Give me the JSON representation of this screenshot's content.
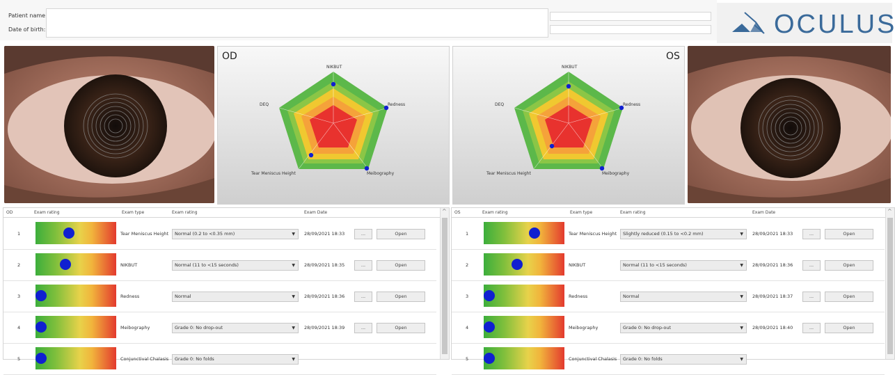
{
  "header": {
    "patient_name_label": "Patient name:",
    "dob_label": "Date of birth:",
    "patient_name_value": "",
    "dob_value": ""
  },
  "logo": {
    "text": "OCULUS",
    "reg": "®"
  },
  "colors": {
    "brand": "#3a6a9a",
    "dot": "#1020d0",
    "green": "#3cae3c",
    "yellow": "#e8d24a",
    "red": "#e33a2e"
  },
  "radar_od": {
    "title": "OD",
    "axes": [
      "NIKBUT",
      "Redness",
      "Meibography",
      "Tear Meniscus Height",
      "DEQ"
    ]
  },
  "radar_os": {
    "title": "OS",
    "axes": [
      "NIKBUT",
      "Redness",
      "Meibography",
      "Tear Meniscus Height",
      "DEQ"
    ]
  },
  "table_od": {
    "headers": {
      "eye": "OD",
      "rating_bar": "Exam rating",
      "type": "Exam type",
      "rating": "Exam rating",
      "date": "Exam Date"
    },
    "rows": [
      {
        "num": "1",
        "level": 0.4,
        "type": "Tear Meniscus Height",
        "rating": "Normal (0.2 to <0.35 mm)",
        "date": "28/09/2021 18:33",
        "more": "...",
        "open": "Open"
      },
      {
        "num": "2",
        "level": 0.35,
        "type": "NIKBUT",
        "rating": "Normal (11 to <15 seconds)",
        "date": "28/09/2021 18:35",
        "more": "...",
        "open": "Open"
      },
      {
        "num": "3",
        "level": 0.0,
        "type": "Redness",
        "rating": "Normal",
        "date": "28/09/2021 18:36",
        "more": "...",
        "open": "Open"
      },
      {
        "num": "4",
        "level": 0.0,
        "type": "Meibography",
        "rating": "Grade 0: No drop-out",
        "date": "28/09/2021 18:39",
        "more": "...",
        "open": "Open"
      },
      {
        "num": "5",
        "level": 0.0,
        "type": "Conjunctival Chalasis",
        "rating": "Grade 0: No folds",
        "date": "",
        "more": "",
        "open": ""
      }
    ]
  },
  "table_os": {
    "headers": {
      "eye": "OS",
      "rating_bar": "Exam rating",
      "type": "Exam type",
      "rating": "Exam rating",
      "date": "Exam Date"
    },
    "rows": [
      {
        "num": "1",
        "level": 0.65,
        "type": "Tear Meniscus Height",
        "rating": "Slightly reduced (0.15 to <0.2 mm)",
        "date": "28/09/2021 18:33",
        "more": "...",
        "open": "Open"
      },
      {
        "num": "2",
        "level": 0.4,
        "type": "NIKBUT",
        "rating": "Normal (11 to <15 seconds)",
        "date": "28/09/2021 18:36",
        "more": "...",
        "open": "Open"
      },
      {
        "num": "3",
        "level": 0.0,
        "type": "Redness",
        "rating": "Normal",
        "date": "28/09/2021 18:37",
        "more": "...",
        "open": "Open"
      },
      {
        "num": "4",
        "level": 0.0,
        "type": "Meibography",
        "rating": "Grade 0: No drop-out",
        "date": "28/09/2021 18:40",
        "more": "...",
        "open": "Open"
      },
      {
        "num": "5",
        "level": 0.0,
        "type": "Conjunctival Chalasis",
        "rating": "Grade 0: No folds",
        "date": "",
        "more": "",
        "open": ""
      }
    ]
  }
}
